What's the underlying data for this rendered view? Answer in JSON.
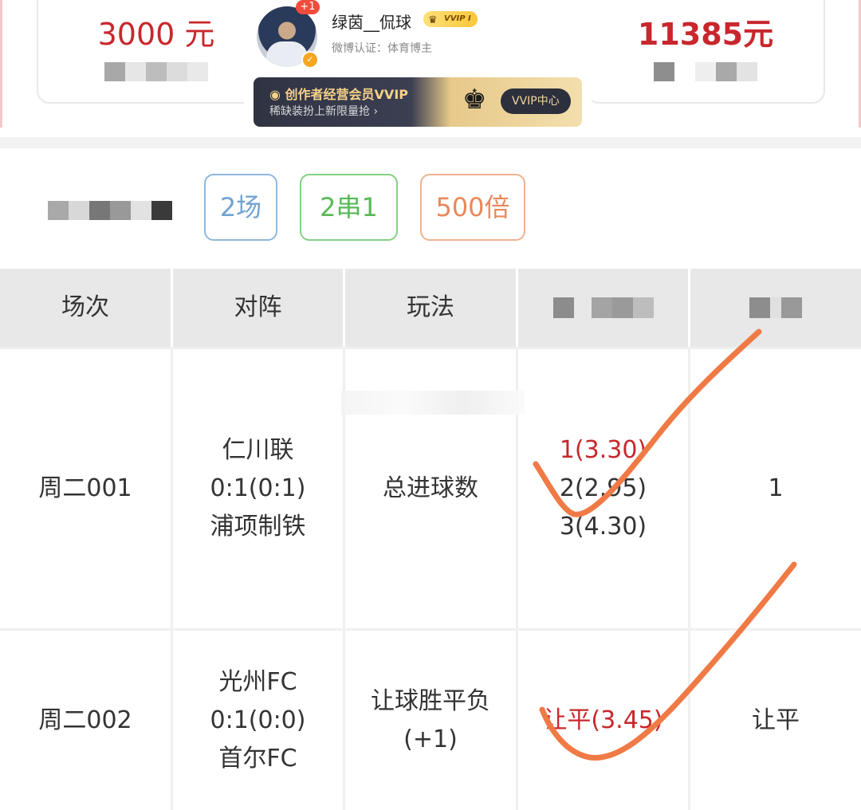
{
  "summary": {
    "left_amount": "3000 元",
    "right_amount": "11385元"
  },
  "weibo": {
    "badge": "+1",
    "name": "绿茵__侃球",
    "vvip_tag": "VVIP I",
    "verified": "微博认证：体育博主",
    "banner_title": "创作者经营会员VVIP",
    "banner_sub": "稀缺装扮上新限量抢 ›",
    "banner_button": "VVIP中心"
  },
  "tags": [
    "2场",
    "2串1",
    "500倍"
  ],
  "table": {
    "headers": [
      "场次",
      "对阵",
      "玩法",
      "",
      ""
    ],
    "rows": [
      {
        "session": "周二001",
        "match": [
          "仁川联",
          "0:1(0:1)",
          "浦项制铁"
        ],
        "play": [
          "总进球数"
        ],
        "picks": [
          "1(3.30)",
          "2(2.95)",
          "3(4.30)"
        ],
        "winning_index": 0,
        "result": "1"
      },
      {
        "session": "周二002",
        "match": [
          "光州FC",
          "0:1(0:0)",
          "首尔FC"
        ],
        "play": [
          "让球胜平负",
          "(+1)"
        ],
        "picks": [
          "让平(3.45)"
        ],
        "winning_index": 0,
        "result": "让平"
      }
    ]
  },
  "colors": {
    "accent_red": "#c8272d",
    "tag_blue": "#6fa3d2",
    "tag_green": "#58b958",
    "tag_orange": "#e8895a",
    "checkmark": "#f07a45"
  },
  "icons": [
    "weibo-logo-icon",
    "crown-icon",
    "verified-icon",
    "checkmark-icon"
  ]
}
